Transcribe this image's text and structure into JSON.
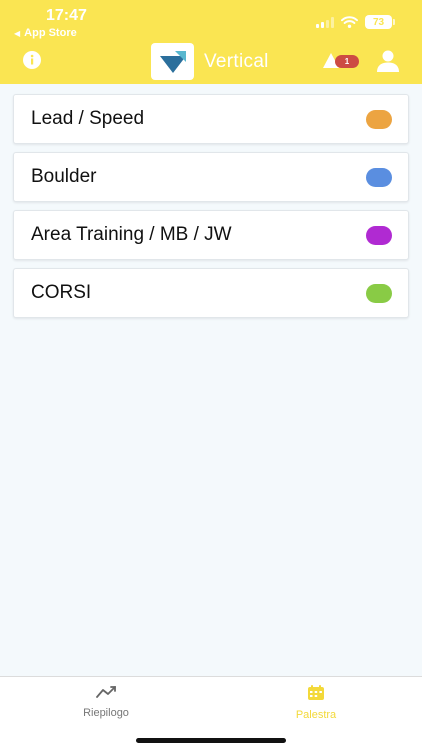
{
  "status_bar": {
    "time": "17:47",
    "back_app": "App Store",
    "battery": "73"
  },
  "header": {
    "title": "Vertical",
    "notification_count": "1",
    "icons": {
      "info": "info-icon",
      "logo": "vertical-logo",
      "notifications": "bell-icon",
      "profile": "user-icon"
    }
  },
  "categories": [
    {
      "label": "Lead / Speed",
      "color": "#eca441"
    },
    {
      "label": "Boulder",
      "color": "#5a8ee0"
    },
    {
      "label": "Area Training / MB / JW",
      "color": "#b02ad2"
    },
    {
      "label": "CORSI",
      "color": "#89cb45"
    }
  ],
  "tabs": [
    {
      "label": "Riepilogo",
      "icon": "trend-line-icon",
      "active": false
    },
    {
      "label": "Palestra",
      "icon": "calendar-icon",
      "active": true
    }
  ],
  "colors": {
    "header_bg": "#fae552",
    "active_tab": "#f3d93a",
    "badge": "#cd4b43",
    "logo_blue": "#2b6f9c",
    "logo_teal": "#58b7cf"
  }
}
